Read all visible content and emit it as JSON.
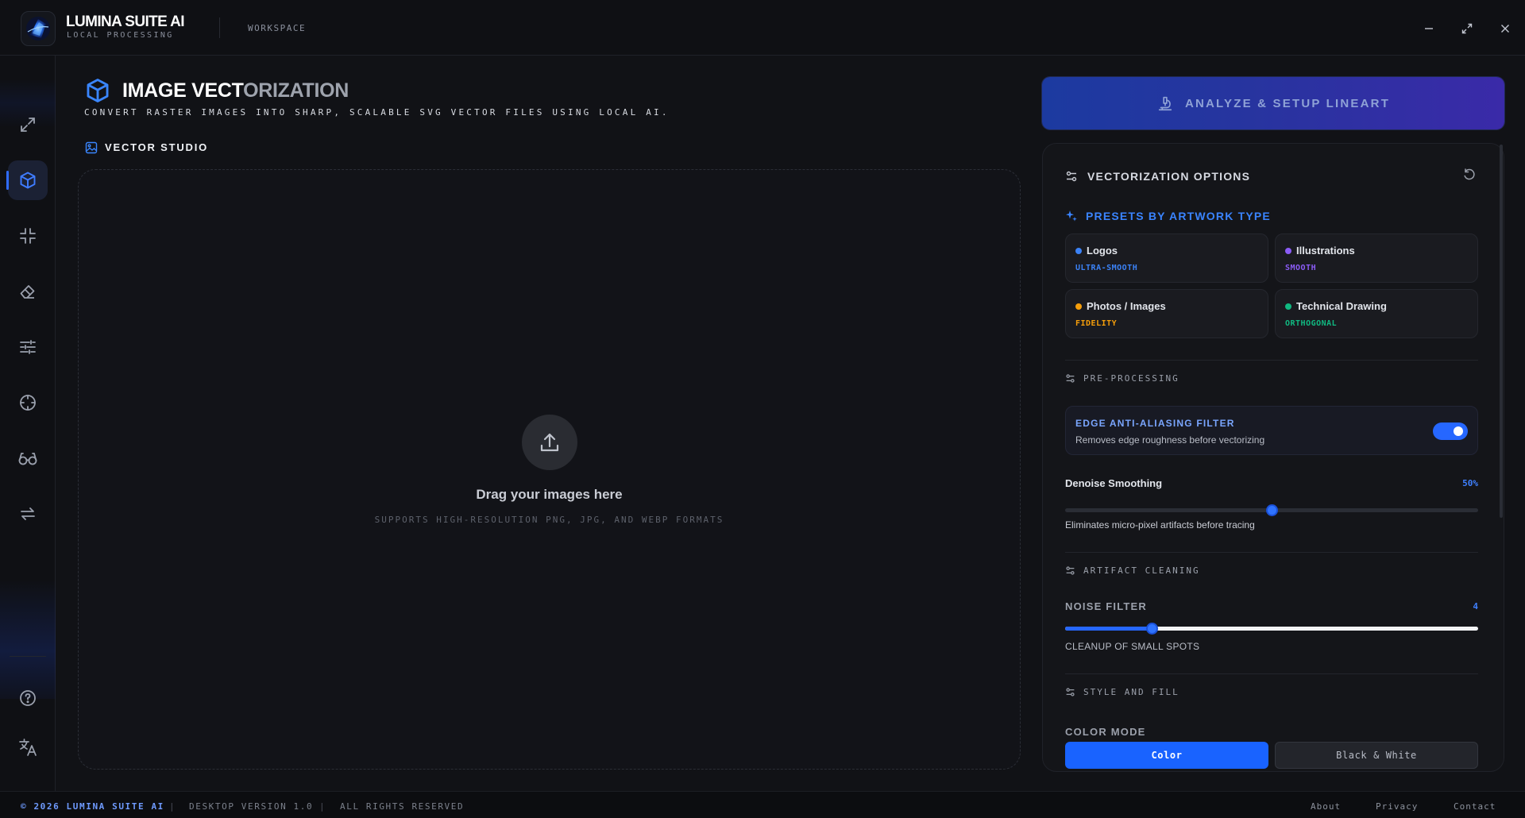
{
  "app": {
    "name": "LUMINA SUITE AI",
    "subtitle": "LOCAL PROCESSING",
    "workspace_label": "WORKSPACE"
  },
  "window_controls": [
    "minimize-icon",
    "maximize-icon",
    "close-icon"
  ],
  "sidebar": {
    "items": [
      {
        "icon": "expand-icon",
        "active": false
      },
      {
        "icon": "cube-icon",
        "active": true
      },
      {
        "icon": "compress-icon",
        "active": false
      },
      {
        "icon": "eraser-icon",
        "active": false
      },
      {
        "icon": "sliders-icon",
        "active": false
      },
      {
        "icon": "crosshair-icon",
        "active": false
      },
      {
        "icon": "glasses-icon",
        "active": false
      },
      {
        "icon": "swap-icon",
        "active": false
      }
    ],
    "bottom_items": [
      {
        "icon": "help-icon"
      },
      {
        "icon": "translate-icon"
      }
    ]
  },
  "main": {
    "title_main": "IMAGE VECT",
    "title_fade": "ORIZATION",
    "subtitle": "CONVERT RASTER IMAGES INTO SHARP, SCALABLE SVG VECTOR FILES USING LOCAL AI.",
    "studio_label": "VECTOR STUDIO",
    "dropzone": {
      "title": "Drag your images here",
      "subtitle": "SUPPORTS HIGH-RESOLUTION PNG, JPG, AND WEBP FORMATS"
    }
  },
  "analyze_button": {
    "label": "ANALYZE & SETUP LINEART"
  },
  "options": {
    "title": "VECTORIZATION OPTIONS",
    "presets_title": "PRESETS BY ARTWORK TYPE",
    "presets": [
      {
        "name": "Logos",
        "tag": "ULTRA-SMOOTH",
        "color": "#3b82f6"
      },
      {
        "name": "Illustrations",
        "tag": "SMOOTH",
        "color": "#8b5cf6"
      },
      {
        "name": "Photos / Images",
        "tag": "FIDELITY",
        "color": "#f59e0b"
      },
      {
        "name": "Technical Drawing",
        "tag": "ORTHOGONAL",
        "color": "#10b981"
      }
    ],
    "preprocessing": {
      "title": "PRE-PROCESSING",
      "edge_filter": {
        "title": "EDGE ANTI-ALIASING FILTER",
        "description": "Removes edge roughness before vectorizing",
        "enabled": true
      },
      "denoise": {
        "label": "Denoise Smoothing",
        "value_text": "50%",
        "value": 0.5,
        "hint": "Eliminates micro-pixel artifacts before tracing"
      }
    },
    "artifact_cleaning": {
      "title": "ARTIFACT CLEANING",
      "noise_filter": {
        "label": "NOISE FILTER",
        "value_text": "4",
        "value": 0.21,
        "hint": "CLEANUP OF SMALL SPOTS"
      }
    },
    "style_fill": {
      "title": "STYLE AND FILL",
      "color_mode_label": "COLOR MODE",
      "color_modes": [
        {
          "label": "Color",
          "selected": true
        },
        {
          "label": "Black & White",
          "selected": false
        }
      ]
    }
  },
  "footer": {
    "copyright": "© 2026 LUMINA SUITE AI",
    "version": "DESKTOP VERSION 1.0",
    "rights": "ALL RIGHTS RESERVED",
    "separator": "|",
    "links": [
      "About",
      "Privacy",
      "Contact"
    ]
  },
  "colors": {
    "accent": "#2667ff",
    "background": "#111216",
    "panel": "#141519"
  }
}
